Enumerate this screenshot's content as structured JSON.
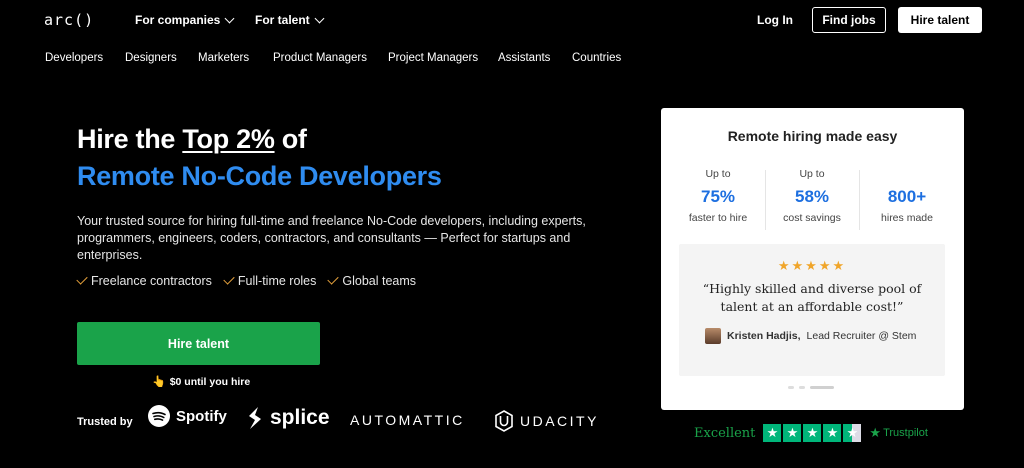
{
  "header": {
    "logo": "arc()",
    "nav": [
      "For companies",
      "For talent"
    ],
    "login": "Log In",
    "find_jobs": "Find jobs",
    "hire_talent": "Hire talent"
  },
  "subnav": [
    "Developers",
    "Designers",
    "Marketers",
    "Product Managers",
    "Project Managers",
    "Assistants",
    "Countries"
  ],
  "hero": {
    "title_prefix": "Hire the ",
    "title_highlight": "Top 2%",
    "title_suffix": " of",
    "subtitle": "Remote No-Code Developers",
    "description": "Your trusted source for hiring full-time and freelance No-Code developers, including experts, programmers, engineers, coders, contractors, and consultants — Perfect for startups and enterprises.",
    "checks": [
      "Freelance contractors",
      "Full-time roles",
      "Global teams"
    ],
    "cta": "Hire talent",
    "cta_note": "$0 until you hire",
    "trusted_by": "Trusted by",
    "brands": [
      "Spotify",
      "splice",
      "AUTOMATTIC",
      "UDACITY"
    ]
  },
  "card": {
    "title": "Remote hiring made easy",
    "stats": [
      {
        "up": "Up to",
        "value": "75%",
        "label": "faster to hire"
      },
      {
        "up": "Up to",
        "value": "58%",
        "label": "cost savings"
      },
      {
        "up": "",
        "value": "800+",
        "label": "hires made"
      }
    ],
    "stars": "★★★★★",
    "quote": "“Highly skilled and diverse pool of talent at an affordable cost!”",
    "author_name": "Kristen Hadjis,",
    "author_role": "Lead Recruiter @ Stem"
  },
  "trustpilot": {
    "rating_text": "Excellent",
    "rating": 4.5,
    "logo": "Trustpilot"
  },
  "colors": {
    "accent_blue": "#2f8cf0",
    "cta_green": "#1aa34a",
    "check_orange": "#e8a33d",
    "trustpilot_green": "#00b67a"
  }
}
